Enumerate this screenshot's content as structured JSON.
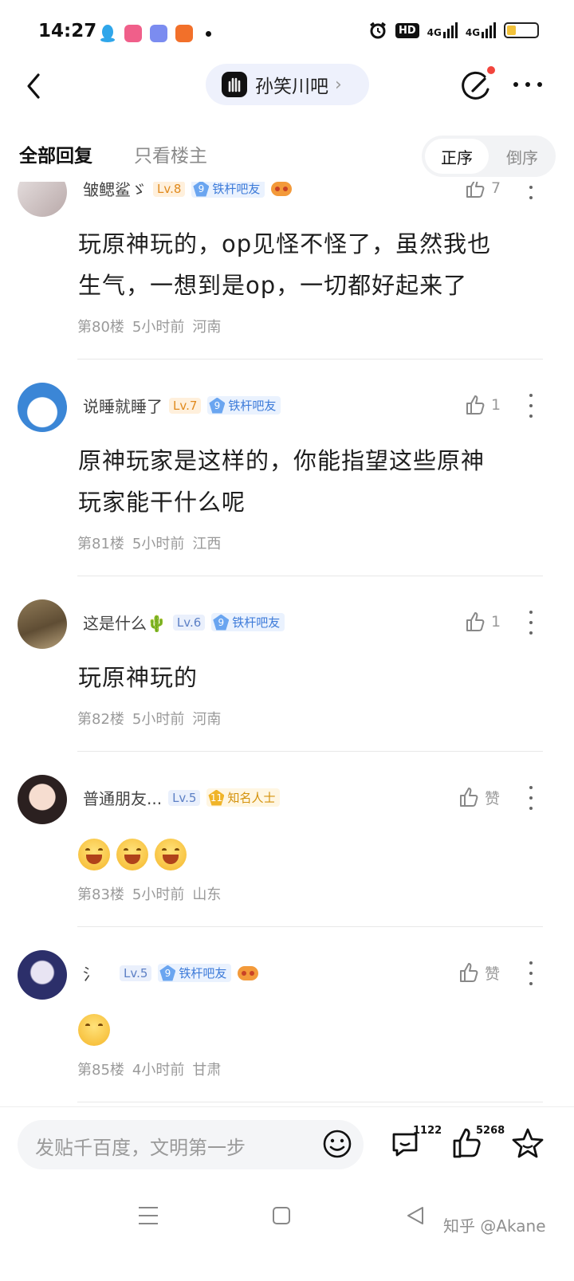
{
  "status_bar": {
    "time": "14:27",
    "network_label_1": "4G",
    "network_label_2": "4G",
    "hd_label": "HD",
    "battery_level": 0.3,
    "app_icons": [
      "qq-icon",
      "bilibili-icon",
      "tieba-icon",
      "app-icon"
    ]
  },
  "header": {
    "forum_name": "孙笑川吧",
    "chevron": "›"
  },
  "tabs": {
    "all_replies": "全部回复",
    "owner_only": "只看楼主",
    "sort_asc": "正序",
    "sort_desc": "倒序"
  },
  "posts": [
    {
      "username": "皱鳃鲨ゞ",
      "level": "Lv.8",
      "badge_num": "9",
      "badge_label": "铁杆吧友",
      "likes": "7",
      "content_line1": "玩原神玩的，op见怪不怪了，虽然我也",
      "content_line2": "生气，一想到是op，一切都好起来了",
      "floor": "第80楼",
      "time": "5小时前",
      "location": "河南"
    },
    {
      "username": "说睡就睡了",
      "level": "Lv.7",
      "badge_num": "9",
      "badge_label": "铁杆吧友",
      "likes": "1",
      "content_line1": "原神玩家是这样的，你能指望这些原神",
      "content_line2": "玩家能干什么呢",
      "floor": "第81楼",
      "time": "5小时前",
      "location": "江西"
    },
    {
      "username": "这是什么🌵",
      "level": "Lv.6",
      "badge_num": "9",
      "badge_label": "铁杆吧友",
      "likes": "1",
      "content_line1": "玩原神玩的",
      "floor": "第82楼",
      "time": "5小时前",
      "location": "河南"
    },
    {
      "username": "普通朋友...",
      "level": "Lv.5",
      "badge_num": "11",
      "badge_label": "知名人士",
      "likes": "赞",
      "floor": "第83楼",
      "time": "5小时前",
      "location": "山东"
    },
    {
      "username": "氵",
      "level": "Lv.5",
      "badge_num": "9",
      "badge_label": "铁杆吧友",
      "likes": "赞",
      "floor": "第85楼",
      "time": "4小时前",
      "location": "甘肃"
    }
  ],
  "bottom_bar": {
    "input_placeholder": "发贴千百度，文明第一步",
    "comment_count": "1122",
    "like_count": "5268"
  },
  "watermark": "知乎 @Akane",
  "colors": {
    "accent_blue": "#3d7bd9",
    "level_orange": "#e08a1e",
    "gold_badge": "#d4920c",
    "notification_red": "#f2453d",
    "pill_bg": "#eef1fc"
  }
}
